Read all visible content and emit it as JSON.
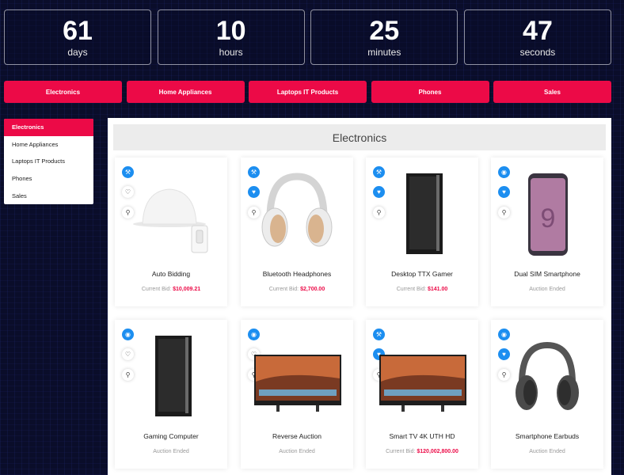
{
  "countdown": [
    {
      "value": "61",
      "unit": "days"
    },
    {
      "value": "10",
      "unit": "hours"
    },
    {
      "value": "25",
      "unit": "minutes"
    },
    {
      "value": "47",
      "unit": "seconds"
    }
  ],
  "tabs": [
    "Electronics",
    "Home Appliances",
    "Laptops IT Products",
    "Phones",
    "Sales"
  ],
  "sidebar": {
    "items": [
      "Electronics",
      "Home Appliances",
      "Laptops IT Products",
      "Phones",
      "Sales"
    ],
    "active": "Electronics"
  },
  "panel": {
    "title": "Electronics"
  },
  "products": [
    {
      "title": "Auto Bidding",
      "status_label": "Current Bid:",
      "amount": "$10,009.21",
      "image": "smart-lamp"
    },
    {
      "title": "Bluetooth Headphones",
      "status_label": "Current Bid:",
      "amount": "$2,700.00",
      "image": "headphones"
    },
    {
      "title": "Desktop TTX Gamer",
      "status_label": "Current Bid:",
      "amount": "$141.00",
      "image": "pc-tower"
    },
    {
      "title": "Dual SIM Smartphone",
      "status_label": "Auction Ended",
      "amount": "",
      "image": "smartphone"
    },
    {
      "title": "Gaming Computer",
      "status_label": "Auction Ended",
      "amount": "",
      "image": "pc-tower"
    },
    {
      "title": "Reverse Auction",
      "status_label": "Auction Ended",
      "amount": "",
      "image": "tv"
    },
    {
      "title": "Smart TV 4K UTH HD",
      "status_label": "Current Bid:",
      "amount": "$120,002,800.00",
      "image": "tv"
    },
    {
      "title": "Smartphone Earbuds",
      "status_label": "Auction Ended",
      "amount": "",
      "image": "earphones"
    }
  ],
  "colors": {
    "accent": "#ec0a47",
    "icon_blue": "#1c8ef0",
    "background": "#0a0d2a"
  }
}
